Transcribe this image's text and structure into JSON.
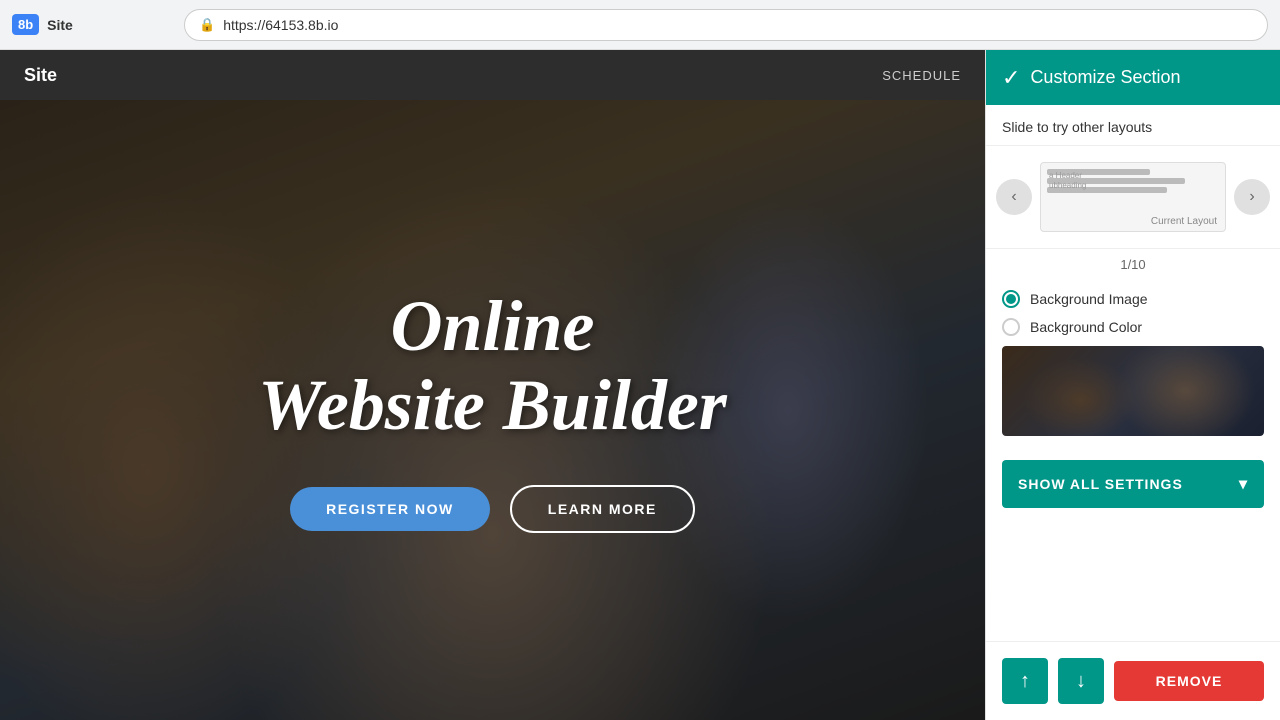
{
  "browser": {
    "logo_label": "8b",
    "site_label": "Site",
    "url": "https://64153.8b.io"
  },
  "site_nav": {
    "logo": "Site",
    "links": [
      "SCHEDULE"
    ]
  },
  "hero": {
    "title_line1": "Online",
    "title_line2": "Website Builder",
    "btn_primary": "REGISTER NOW",
    "btn_secondary": "LEARN MORE"
  },
  "panel": {
    "header_title": "Customize Section",
    "subtitle": "Slide to try other layouts",
    "layout_counter": "1/10",
    "layout_label": "Current Layout",
    "layout_prev_icon": "‹",
    "layout_next_icon": "›",
    "bg_image_label": "Background Image",
    "bg_color_label": "Background Color",
    "show_settings_label": "SHOW ALL SETTINGS",
    "chevron_icon": "▾",
    "btn_up_icon": "↑",
    "btn_down_icon": "↓",
    "btn_remove_label": "REMOVE",
    "bg_image_selected": true,
    "bg_color_selected": false
  }
}
